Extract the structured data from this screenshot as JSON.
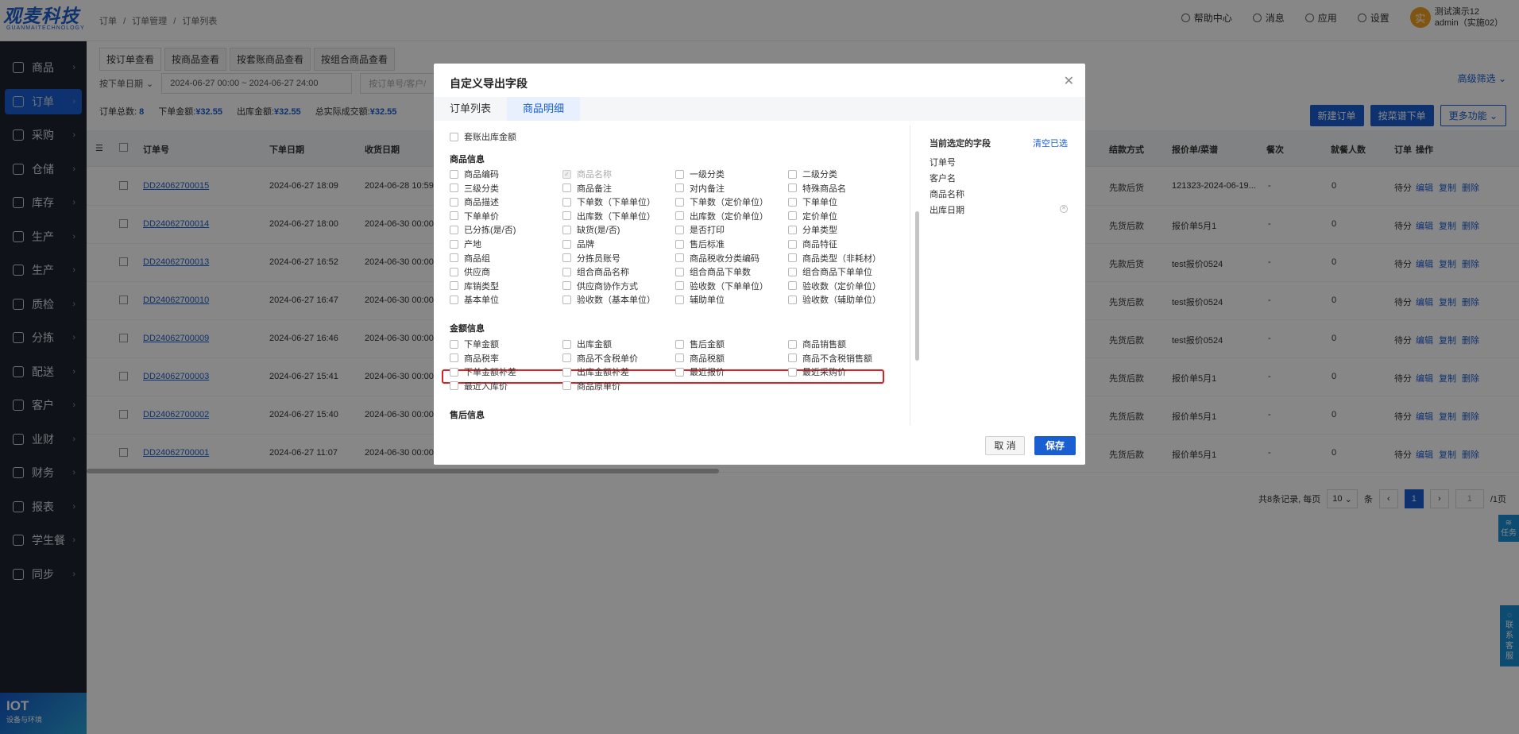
{
  "logo": {
    "main": "观麦科技",
    "sub": "GUANMAITECHNOLOGY"
  },
  "sidebar": {
    "items": [
      {
        "label": "商品",
        "icon": "cube-icon"
      },
      {
        "label": "订单",
        "icon": "clipboard-icon"
      },
      {
        "label": "采购",
        "icon": "bag-icon"
      },
      {
        "label": "仓储",
        "icon": "warehouse-icon"
      },
      {
        "label": "库存",
        "icon": "inventory-icon"
      },
      {
        "label": "生产",
        "icon": "production-icon"
      },
      {
        "label": "生产",
        "icon": "production-icon"
      },
      {
        "label": "质检",
        "icon": "shield-icon"
      },
      {
        "label": "分拣",
        "icon": "sort-icon"
      },
      {
        "label": "配送",
        "icon": "truck-icon"
      },
      {
        "label": "客户",
        "icon": "user-icon"
      },
      {
        "label": "业财",
        "icon": "chart-icon"
      },
      {
        "label": "财务",
        "icon": "wallet-icon"
      },
      {
        "label": "报表",
        "icon": "report-icon"
      },
      {
        "label": "学生餐",
        "icon": "meal-icon"
      },
      {
        "label": "同步",
        "icon": "sync-icon"
      }
    ],
    "iot_title": "IOT",
    "iot_sub": "设备与环境"
  },
  "breadcrumb": [
    "订单",
    "/",
    "订单管理",
    "/",
    "订单列表"
  ],
  "topbar": {
    "help": "帮助中心",
    "messages": "消息",
    "apps": "应用",
    "settings": "设置",
    "avatar": "实",
    "user_line1": "测试演示12",
    "user_line2": "admin（实施02）"
  },
  "subtabs": [
    "按订单查看",
    "按商品查看",
    "按套账商品查看",
    "按组合商品查看"
  ],
  "filters": {
    "date_type": "按下单日期",
    "date_range": "2024-06-27 00:00 ~ 2024-06-27 24:00",
    "search_placeholder": "按订单号/客户/",
    "advanced": "高级筛选"
  },
  "summary": {
    "count_label": "订单总数:",
    "count": "8",
    "order_amt_label": "下单金额:",
    "order_amt": "¥32.55",
    "out_amt_label": "出库金额:",
    "out_amt": "¥32.55",
    "real_amt_label": "总实际成交额:",
    "real_amt": "¥32.55"
  },
  "toolbar": {
    "new_order": "新建订单",
    "by_menu": "按菜谱下单",
    "more": "更多功能"
  },
  "table": {
    "headers": {
      "order_no": "订单号",
      "order_date": "下单日期",
      "recv_date": "收货日期",
      "pay": "结款方式",
      "quote": "报价单/菜谱",
      "meal": "餐次",
      "diners": "就餐人数",
      "status": "订单",
      "ops": "操作"
    },
    "rows": [
      {
        "order_no": "DD24062700015",
        "order_date": "2024-06-27 18:09",
        "recv_date": "2024-06-28 10:59",
        "pay": "先款后货",
        "quote": "121323-2024-06-19...",
        "meal": "-",
        "diners": "0",
        "status": "待分"
      },
      {
        "order_no": "DD24062700014",
        "order_date": "2024-06-27 18:00",
        "recv_date": "2024-06-30 00:00",
        "pay": "先货后款",
        "quote": "报价单5月1",
        "meal": "-",
        "diners": "0",
        "status": "待分"
      },
      {
        "order_no": "DD24062700013",
        "order_date": "2024-06-27 16:52",
        "recv_date": "2024-06-30 00:00",
        "pay": "先款后货",
        "quote": "test报价0524",
        "meal": "-",
        "diners": "0",
        "status": "待分"
      },
      {
        "order_no": "DD24062700010",
        "order_date": "2024-06-27 16:47",
        "recv_date": "2024-06-30 00:00",
        "pay": "先货后款",
        "quote": "test报价0524",
        "meal": "-",
        "diners": "0",
        "status": "待分"
      },
      {
        "order_no": "DD24062700009",
        "order_date": "2024-06-27 16:46",
        "recv_date": "2024-06-30 00:00",
        "pay": "先货后款",
        "quote": "test报价0524",
        "meal": "-",
        "diners": "0",
        "status": "待分"
      },
      {
        "order_no": "DD24062700003",
        "order_date": "2024-06-27 15:41",
        "recv_date": "2024-06-30 00:00",
        "pay": "先货后款",
        "quote": "报价单5月1",
        "meal": "-",
        "diners": "0",
        "status": "待分"
      },
      {
        "order_no": "DD24062700002",
        "order_date": "2024-06-27 15:40",
        "recv_date": "2024-06-30 00:00",
        "pay": "先货后款",
        "quote": "报价单5月1",
        "meal": "-",
        "diners": "0",
        "status": "待分"
      },
      {
        "order_no": "DD24062700001",
        "order_date": "2024-06-27 11:07",
        "recv_date": "2024-06-30 00:00",
        "pay": "先货后款",
        "quote": "报价单5月1",
        "meal": "-",
        "diners": "0",
        "status": "待分"
      }
    ],
    "ops": [
      "编辑",
      "复制",
      "删除"
    ]
  },
  "pager": {
    "total_text": "共8条记录, 每页",
    "page_size": "10",
    "unit": "条",
    "current": "1",
    "jump": "1",
    "total_pages": "/1页"
  },
  "side_tags": {
    "task": "任务",
    "contact": "联系客服"
  },
  "modal": {
    "title": "自定义导出字段",
    "tabs": [
      "订单列表",
      "商品明细"
    ],
    "cut_fields": [
      "套账出库金额"
    ],
    "goods_section": "商品信息",
    "goods_fields": [
      "商品编码",
      "商品名称",
      "一级分类",
      "二级分类",
      "三级分类",
      "商品备注",
      "对内备注",
      "特殊商品名",
      "商品描述",
      "下单数（下单单位）",
      "下单数（定价单位）",
      "下单单位",
      "下单单价",
      "出库数（下单单位）",
      "出库数（定价单位）",
      "定价单位",
      "已分拣(是/否)",
      "缺货(是/否)",
      "是否打印",
      "分单类型",
      "产地",
      "品牌",
      "售后标准",
      "商品特征",
      "商品组",
      "分拣员账号",
      "商品税收分类编码",
      "商品类型（非耗材）",
      "供应商",
      "组合商品名称",
      "组合商品下单数",
      "组合商品下单单位",
      "库销类型",
      "供应商协作方式",
      "验收数（下单单位）",
      "验收数（定价单位）",
      "基本单位",
      "验收数（基本单位）",
      "辅助单位",
      "验收数（辅助单位）"
    ],
    "amount_section": "金额信息",
    "amount_fields": [
      "下单金额",
      "出库金额",
      "售后金额",
      "商品销售额",
      "商品税率",
      "商品不含税单价",
      "商品税额",
      "商品不含税销售额",
      "下单金额补差",
      "出库金额补差",
      "最近报价",
      "最近采购价",
      "最近入库价",
      "商品原单价"
    ],
    "aftersale_section": "售后信息",
    "selected_title": "当前选定的字段",
    "clear_label": "清空已选",
    "selected": [
      "订单号",
      "客户名",
      "商品名称",
      "出库日期"
    ],
    "cancel": "取 消",
    "save": "保存"
  }
}
